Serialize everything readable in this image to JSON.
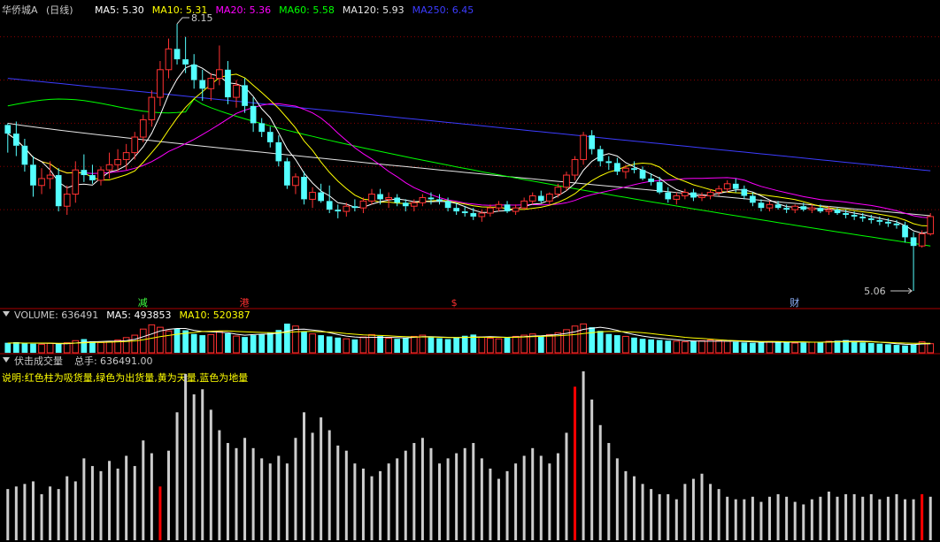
{
  "colors": {
    "background": "#000000",
    "up": "#ff3232",
    "down": "#54ffff",
    "ma5": "#ffffff",
    "ma10": "#ffff00",
    "ma20": "#ff00ff",
    "ma60": "#00ff00",
    "ma120": "#e6e6e6",
    "ma250": "#3c3cff",
    "vol_bar": "#cccccc",
    "vol_red": "#ff0000",
    "vol_green": "#00ff00",
    "separator": "#aa0000",
    "grid": "#880000",
    "note": "#ffff00"
  },
  "price_panel": {
    "title": "华侨城A",
    "period": "(日线)",
    "indicators": [
      {
        "label": "MA5:",
        "value": "5.30",
        "color": "#ffffff"
      },
      {
        "label": "MA10:",
        "value": "5.31",
        "color": "#ffff00"
      },
      {
        "label": "MA20:",
        "value": "5.36",
        "color": "#ff00ff"
      },
      {
        "label": "MA60:",
        "value": "5.58",
        "color": "#00ff00"
      },
      {
        "label": "MA120:",
        "value": "5.93",
        "color": "#e6e6e6"
      },
      {
        "label": "MA250:",
        "value": "6.45",
        "color": "#3c3cff"
      }
    ],
    "high_label": "8.15",
    "low_label": "5.06",
    "events": [
      {
        "text": "减",
        "color": "#40ff40"
      },
      {
        "text": "港",
        "color": "#ff3030"
      },
      {
        "text": "$",
        "color": "#ff3030"
      },
      {
        "text": "财",
        "color": "#8fb4ff"
      }
    ]
  },
  "volume_panel": {
    "indicators": [
      {
        "label": "VOLUME:",
        "value": "636491",
        "color": "#c8c8c8"
      },
      {
        "label": "MA5:",
        "value": "493853",
        "color": "#ffffff"
      },
      {
        "label": "MA10:",
        "value": "520387",
        "color": "#ffff00"
      }
    ]
  },
  "custom_panel": {
    "title": "伏击成交量",
    "total_label": "总手:",
    "total_value": "636491.00",
    "note": "说明:红色柱为吸货量,绿色为出货量,黄为天量,蓝色为地量"
  },
  "chart_data": {
    "type": "candlestick",
    "ylim": [
      5.06,
      8.15
    ],
    "candles": [
      [
        6.98,
        7.0,
        6.66,
        6.88
      ],
      [
        6.88,
        7.02,
        6.62,
        6.74
      ],
      [
        6.74,
        6.82,
        6.44,
        6.52
      ],
      [
        6.52,
        6.62,
        6.15,
        6.28
      ],
      [
        6.28,
        6.48,
        6.18,
        6.36
      ],
      [
        6.36,
        6.56,
        6.24,
        6.4
      ],
      [
        6.4,
        6.48,
        5.98,
        6.04
      ],
      [
        6.04,
        6.28,
        5.94,
        6.18
      ],
      [
        6.18,
        6.56,
        6.08,
        6.46
      ],
      [
        6.46,
        6.64,
        6.32,
        6.4
      ],
      [
        6.4,
        6.52,
        6.3,
        6.34
      ],
      [
        6.34,
        6.5,
        6.28,
        6.46
      ],
      [
        6.46,
        6.66,
        6.36,
        6.52
      ],
      [
        6.52,
        6.7,
        6.44,
        6.58
      ],
      [
        6.58,
        6.76,
        6.46,
        6.66
      ],
      [
        6.66,
        6.9,
        6.58,
        6.84
      ],
      [
        6.84,
        7.1,
        6.78,
        7.04
      ],
      [
        7.04,
        7.38,
        6.96,
        7.3
      ],
      [
        7.3,
        7.72,
        7.2,
        7.62
      ],
      [
        7.62,
        7.98,
        7.52,
        7.86
      ],
      [
        7.86,
        8.15,
        7.68,
        7.74
      ],
      [
        7.74,
        8.0,
        7.58,
        7.68
      ],
      [
        7.68,
        7.8,
        7.4,
        7.5
      ],
      [
        7.5,
        7.62,
        7.26,
        7.4
      ],
      [
        7.4,
        7.58,
        7.26,
        7.52
      ],
      [
        7.52,
        7.9,
        7.44,
        7.62
      ],
      [
        7.62,
        7.72,
        7.22,
        7.3
      ],
      [
        7.3,
        7.5,
        7.18,
        7.44
      ],
      [
        7.44,
        7.52,
        7.12,
        7.2
      ],
      [
        7.2,
        7.3,
        6.9,
        7.0
      ],
      [
        7.0,
        7.06,
        6.84,
        6.9
      ],
      [
        6.9,
        6.96,
        6.72,
        6.78
      ],
      [
        6.78,
        6.86,
        6.5,
        6.56
      ],
      [
        6.56,
        6.6,
        6.24,
        6.28
      ],
      [
        6.28,
        6.42,
        6.18,
        6.38
      ],
      [
        6.38,
        6.44,
        6.06,
        6.12
      ],
      [
        6.12,
        6.26,
        6.02,
        6.2
      ],
      [
        6.2,
        6.3,
        6.08,
        6.1
      ],
      [
        6.1,
        6.28,
        5.96,
        6.0
      ],
      [
        6.0,
        6.06,
        5.9,
        5.98
      ],
      [
        5.98,
        6.08,
        5.92,
        6.04
      ],
      [
        6.04,
        6.12,
        5.98,
        6.02
      ],
      [
        6.02,
        6.14,
        5.96,
        6.1
      ],
      [
        6.1,
        6.24,
        6.06,
        6.18
      ],
      [
        6.18,
        6.24,
        6.06,
        6.12
      ],
      [
        6.12,
        6.2,
        6.02,
        6.14
      ],
      [
        6.14,
        6.18,
        6.04,
        6.08
      ],
      [
        6.08,
        6.12,
        5.98,
        6.04
      ],
      [
        6.04,
        6.12,
        5.98,
        6.08
      ],
      [
        6.08,
        6.18,
        6.04,
        6.14
      ],
      [
        6.14,
        6.2,
        6.06,
        6.12
      ],
      [
        6.12,
        6.18,
        6.06,
        6.1
      ],
      [
        6.1,
        6.14,
        5.98,
        6.02
      ],
      [
        6.02,
        6.08,
        5.94,
        5.98
      ],
      [
        5.98,
        6.04,
        5.92,
        5.96
      ],
      [
        5.96,
        6.02,
        5.88,
        5.92
      ],
      [
        5.92,
        6.0,
        5.86,
        5.96
      ],
      [
        5.96,
        6.06,
        5.92,
        6.02
      ],
      [
        6.02,
        6.1,
        5.98,
        6.06
      ],
      [
        6.06,
        6.1,
        5.96,
        5.98
      ],
      [
        5.98,
        6.06,
        5.94,
        6.02
      ],
      [
        6.02,
        6.14,
        6.0,
        6.1
      ],
      [
        6.1,
        6.2,
        6.06,
        6.16
      ],
      [
        6.16,
        6.22,
        6.08,
        6.1
      ],
      [
        6.1,
        6.2,
        6.06,
        6.18
      ],
      [
        6.18,
        6.3,
        6.14,
        6.26
      ],
      [
        6.26,
        6.44,
        6.22,
        6.4
      ],
      [
        6.4,
        6.62,
        6.34,
        6.58
      ],
      [
        6.58,
        6.9,
        6.52,
        6.86
      ],
      [
        6.86,
        6.92,
        6.64,
        6.7
      ],
      [
        6.7,
        6.74,
        6.5,
        6.56
      ],
      [
        6.56,
        6.62,
        6.46,
        6.54
      ],
      [
        6.54,
        6.6,
        6.4,
        6.44
      ],
      [
        6.44,
        6.52,
        6.36,
        6.48
      ],
      [
        6.48,
        6.56,
        6.42,
        6.46
      ],
      [
        6.46,
        6.5,
        6.34,
        6.36
      ],
      [
        6.36,
        6.42,
        6.28,
        6.32
      ],
      [
        6.32,
        6.38,
        6.18,
        6.2
      ],
      [
        6.2,
        6.26,
        6.08,
        6.12
      ],
      [
        6.12,
        6.2,
        6.06,
        6.16
      ],
      [
        6.16,
        6.24,
        6.12,
        6.2
      ],
      [
        6.2,
        6.24,
        6.1,
        6.14
      ],
      [
        6.14,
        6.2,
        6.1,
        6.16
      ],
      [
        6.16,
        6.24,
        6.12,
        6.2
      ],
      [
        6.2,
        6.28,
        6.16,
        6.24
      ],
      [
        6.24,
        6.34,
        6.2,
        6.3
      ],
      [
        6.3,
        6.36,
        6.2,
        6.24
      ],
      [
        6.24,
        6.28,
        6.12,
        6.16
      ],
      [
        6.16,
        6.2,
        6.04,
        6.08
      ],
      [
        6.08,
        6.12,
        5.98,
        6.02
      ],
      [
        6.02,
        6.1,
        5.98,
        6.06
      ],
      [
        6.06,
        6.1,
        6.0,
        6.02
      ],
      [
        6.02,
        6.06,
        5.96,
        6.0
      ],
      [
        6.0,
        6.06,
        5.96,
        6.04
      ],
      [
        6.04,
        6.08,
        5.98,
        6.0
      ],
      [
        6.0,
        6.06,
        5.96,
        6.02
      ],
      [
        6.02,
        6.06,
        5.96,
        5.98
      ],
      [
        5.98,
        6.04,
        5.94,
        6.0
      ],
      [
        6.0,
        6.02,
        5.94,
        5.96
      ],
      [
        5.96,
        6.0,
        5.9,
        5.94
      ],
      [
        5.94,
        5.98,
        5.88,
        5.92
      ],
      [
        5.92,
        5.96,
        5.86,
        5.9
      ],
      [
        5.9,
        5.94,
        5.84,
        5.88
      ],
      [
        5.88,
        5.92,
        5.82,
        5.86
      ],
      [
        5.86,
        5.9,
        5.8,
        5.84
      ],
      [
        5.84,
        5.88,
        5.78,
        5.82
      ],
      [
        5.82,
        5.86,
        5.62,
        5.68
      ],
      [
        5.68,
        5.74,
        5.06,
        5.58
      ],
      [
        5.58,
        5.76,
        5.56,
        5.72
      ],
      [
        5.72,
        5.96,
        5.7,
        5.92
      ]
    ],
    "volume": [
      33,
      35,
      32,
      30,
      28,
      31,
      29,
      33,
      40,
      45,
      38,
      34,
      37,
      42,
      50,
      58,
      78,
      92,
      84,
      72,
      80,
      74,
      62,
      58,
      60,
      70,
      64,
      55,
      52,
      58,
      60,
      66,
      75,
      96,
      88,
      70,
      62,
      58,
      54,
      50,
      46,
      44,
      52,
      60,
      55,
      48,
      46,
      50,
      54,
      58,
      52,
      48,
      45,
      50,
      56,
      60,
      52,
      48,
      46,
      50,
      54,
      58,
      62,
      56,
      60,
      66,
      76,
      88,
      95,
      84,
      72,
      62,
      58,
      54,
      50,
      46,
      44,
      42,
      40,
      38,
      36,
      38,
      40,
      42,
      40,
      38,
      36,
      34,
      33,
      35,
      37,
      36,
      34,
      32,
      33,
      35,
      36,
      38,
      40,
      42,
      38,
      34,
      32,
      30,
      28,
      26,
      24,
      28,
      36,
      30
    ],
    "volume_ma5": [
      32,
      33,
      32,
      32,
      31,
      31,
      30,
      30,
      32,
      35,
      36,
      37,
      38,
      38,
      40,
      44,
      53,
      62,
      72,
      77,
      80,
      80,
      74,
      70,
      69,
      68,
      66,
      61,
      58,
      60,
      61,
      62,
      65,
      71,
      77,
      78,
      75,
      72,
      66,
      60,
      55,
      52,
      50,
      51,
      51,
      51,
      50,
      49,
      51,
      53,
      53,
      52,
      51,
      50,
      50,
      52,
      52,
      53,
      52,
      51,
      52,
      53,
      55,
      56,
      58,
      60,
      64,
      69,
      77,
      81,
      84,
      80,
      74,
      66,
      60,
      55,
      51,
      48,
      45,
      43,
      40,
      39,
      38,
      38,
      38,
      38,
      38,
      37,
      36,
      35,
      35,
      35,
      35,
      35,
      35,
      35,
      35,
      36,
      37,
      38,
      38,
      38,
      37,
      35,
      33,
      30,
      28,
      27,
      29,
      30
    ],
    "volume_ma10": [
      32,
      32,
      32,
      32,
      32,
      32,
      31,
      31,
      32,
      33,
      34,
      34,
      35,
      36,
      37,
      39,
      43,
      48,
      53,
      57,
      61,
      64,
      67,
      70,
      71,
      72,
      72,
      70,
      69,
      68,
      67,
      66,
      66,
      67,
      69,
      70,
      70,
      69,
      68,
      66,
      63,
      61,
      59,
      58,
      57,
      56,
      54,
      53,
      52,
      52,
      52,
      51,
      50,
      50,
      51,
      51,
      51,
      51,
      51,
      51,
      51,
      52,
      53,
      54,
      55,
      56,
      58,
      60,
      63,
      66,
      69,
      70,
      70,
      69,
      68,
      66,
      63,
      60,
      57,
      54,
      51,
      49,
      47,
      45,
      43,
      41,
      40,
      39,
      38,
      37,
      37,
      37,
      36,
      36,
      36,
      35,
      35,
      35,
      36,
      36,
      36,
      36,
      36,
      35,
      34,
      33,
      32,
      31,
      31,
      31
    ],
    "custom_bars": [
      20,
      21,
      22,
      23,
      18,
      21,
      20,
      25,
      23,
      32,
      29,
      27,
      31,
      28,
      33,
      29,
      39,
      34,
      21,
      35,
      50,
      65,
      57,
      59,
      51,
      43,
      38,
      36,
      40,
      36,
      32,
      30,
      33,
      30,
      40,
      50,
      42,
      48,
      43,
      37,
      35,
      30,
      28,
      25,
      27,
      30,
      32,
      35,
      38,
      40,
      36,
      30,
      32,
      34,
      36,
      38,
      32,
      28,
      24,
      27,
      30,
      33,
      36,
      33,
      30,
      34,
      42,
      60,
      66,
      55,
      45,
      38,
      32,
      27,
      25,
      22,
      20,
      18,
      18,
      16,
      22,
      24,
      26,
      22,
      20,
      17,
      16,
      16,
      17,
      15,
      17,
      18,
      17,
      15,
      14,
      16,
      17,
      19,
      17,
      18,
      18,
      17,
      18,
      16,
      17,
      18,
      16,
      16,
      18,
      17
    ],
    "custom_highlights": {
      "18": "red",
      "67": "red",
      "108": "red",
      "121": "green",
      "123": "red"
    }
  }
}
